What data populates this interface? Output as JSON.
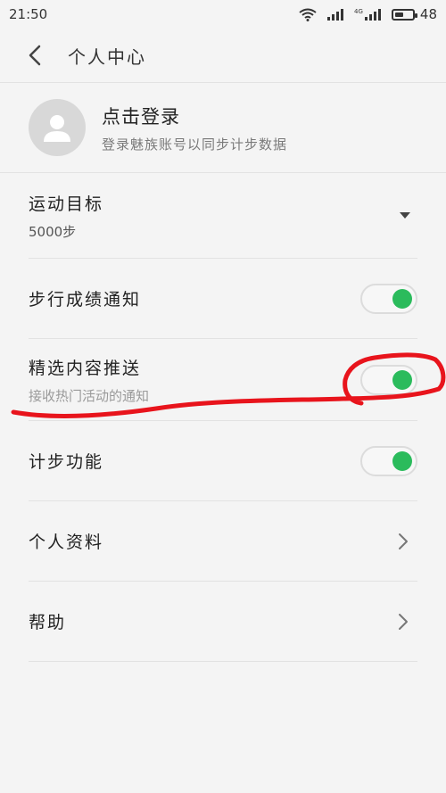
{
  "status": {
    "time": "21:50",
    "network": "4G",
    "battery": "48",
    "battery_level": 0.48
  },
  "header": {
    "title": "个人中心"
  },
  "profile": {
    "login": "点击登录",
    "subtitle": "登录魅族账号以同步计步数据"
  },
  "settings": {
    "goal": {
      "label": "运动目标",
      "value": "5000步"
    },
    "step_notify": {
      "label": "步行成绩通知",
      "on": true
    },
    "featured": {
      "label": "精选内容推送",
      "subtitle": "接收热门活动的通知",
      "on": true
    },
    "step_count": {
      "label": "计步功能",
      "on": true
    },
    "profile_info": {
      "label": "个人资料"
    },
    "help": {
      "label": "帮助"
    }
  },
  "colors": {
    "accent": "#2bbb5c",
    "annotation": "#e8141c"
  }
}
